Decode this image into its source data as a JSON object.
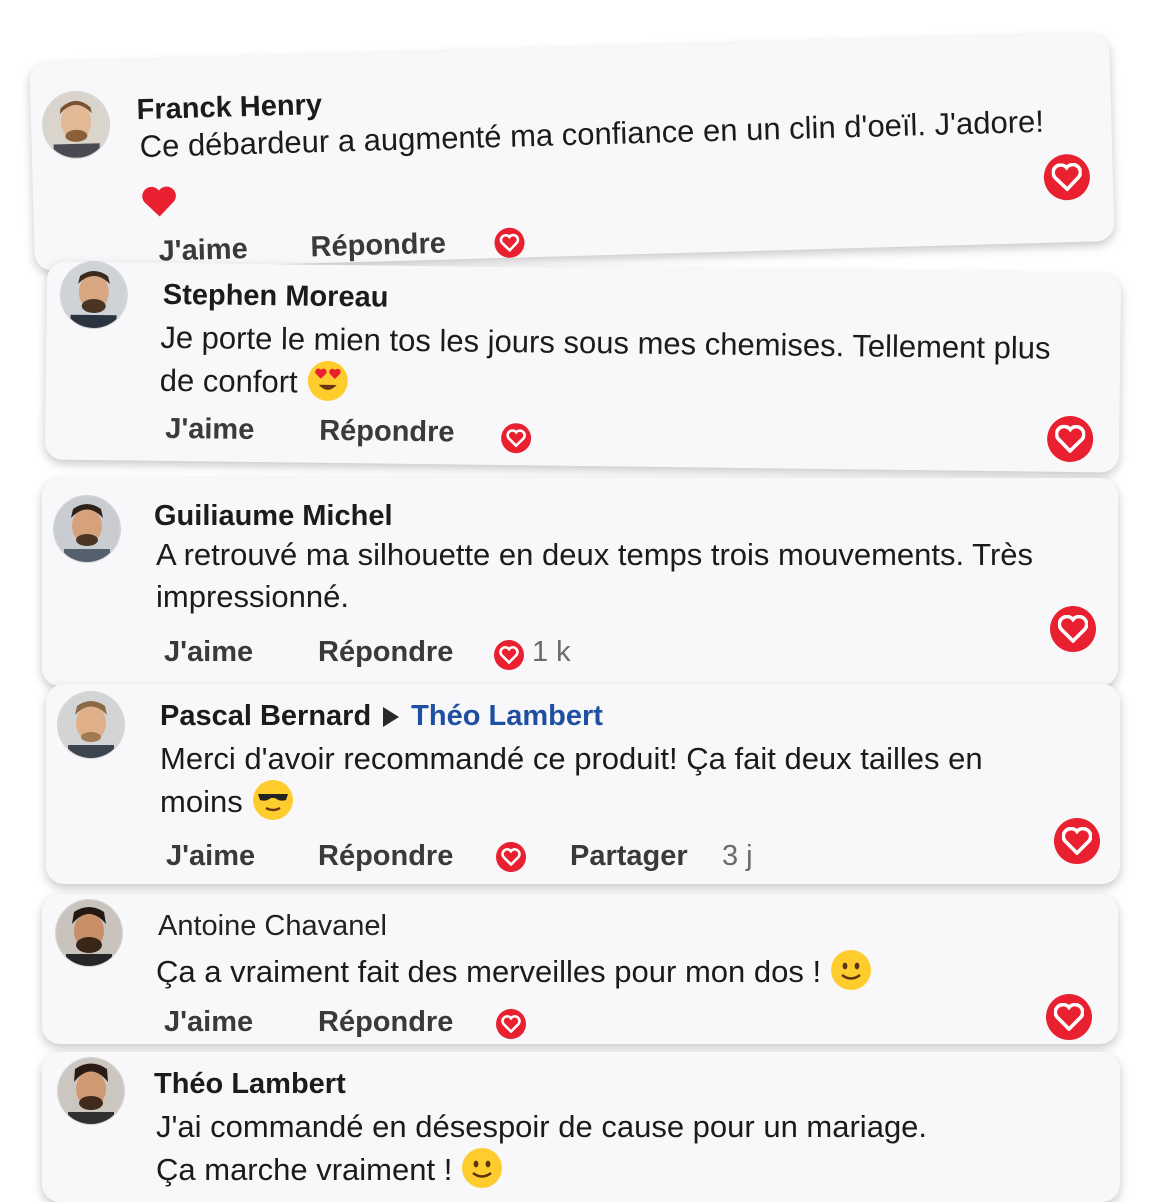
{
  "comments": [
    {
      "name": "Franck Henry",
      "text": "Ce débardeur a augmenté ma confiance en un clin d'oeïl. J'adore!",
      "like_label": "J'aime",
      "reply_label": "Répondre"
    },
    {
      "name": "Stephen Moreau",
      "text_line1": "Je porte le mien tos les jours sous mes chemises. Tellement plus",
      "text_line2": "de confort",
      "emoji": "heart-eyes-emoji",
      "like_label": "J'aime",
      "reply_label": "Répondre"
    },
    {
      "name": "Guiliaume Michel",
      "text_line1": "A retrouvé ma silhouette en deux temps trois mouvements.  Très",
      "text_line2": "impressionné.",
      "like_label": "J'aime",
      "reply_label": "Répondre",
      "reaction_count": "1 k"
    },
    {
      "name": "Pascal Bernard",
      "reply_to": "Théo Lambert",
      "text_line1": "Merci d'avoir recommandé ce produit! Ça fait deux tailles en",
      "text_line2": "moins",
      "emoji": "sunglasses-emoji",
      "like_label": "J'aime",
      "reply_label": "Répondre",
      "share_label": "Partager",
      "time": "3 j"
    },
    {
      "name": "Antoine Chavanel",
      "text": "Ça a vraiment fait des merveilles pour mon dos !",
      "emoji": "smile-emoji",
      "like_label": "J'aime",
      "reply_label": "Répondre"
    },
    {
      "name": "Théo Lambert",
      "text_line1": "J'ai commandé en désespoir de cause pour un mariage.",
      "text_line2": "Ça marche vraiment !",
      "emoji": "smile-emoji"
    }
  ],
  "colors": {
    "heart": "#e8202f",
    "reply_to_name": "#1e4fa0",
    "emoji": "#ffcc2e"
  }
}
